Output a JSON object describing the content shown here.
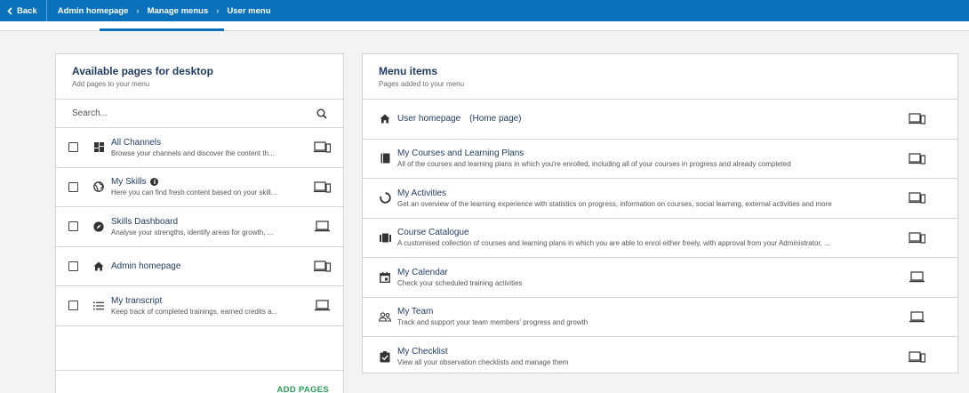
{
  "topbar": {
    "back_label": "Back",
    "breadcrumbs": [
      "Admin homepage",
      "Manage menus",
      "User menu"
    ],
    "accent": "#0a72bd"
  },
  "available": {
    "title": "Available pages for desktop",
    "subtitle": "Add pages to your menu",
    "search_placeholder": "Search...",
    "items": [
      {
        "title": "All Channels",
        "desc": "Browse your channels and discover the content th...",
        "icon": "grid-icon",
        "device": "desktop-mobile-icon"
      },
      {
        "title": "My Skills",
        "desc": "Here you can find fresh content based on your skill...",
        "icon": "globe-icon",
        "device": "desktop-mobile-icon",
        "info": "i"
      },
      {
        "title": "Skills Dashboard",
        "desc": "Analyse your strengths, identify areas for growth, ...",
        "icon": "compass-icon",
        "device": "laptop-icon"
      },
      {
        "title": "Admin homepage",
        "desc": "",
        "icon": "home-icon",
        "device": "desktop-mobile-icon"
      },
      {
        "title": "My transcript",
        "desc": "Keep track of completed trainings, earned credits a...",
        "icon": "list-icon",
        "device": "laptop-icon"
      }
    ],
    "add_label": "ADD PAGES",
    "add_color": "#2a9d57"
  },
  "menu": {
    "title": "Menu items",
    "subtitle": "Pages added to your menu",
    "items": [
      {
        "title": "User homepage",
        "suffix": "(Home page)",
        "desc": "",
        "icon": "home-icon",
        "device": "desktop-mobile-icon"
      },
      {
        "title": "My Courses and Learning Plans",
        "desc": "All of the courses and learning plans in which you're enrolled, including all of your courses in progress and already completed",
        "icon": "book-icon",
        "device": "desktop-mobile-icon"
      },
      {
        "title": "My Activities",
        "desc": "Get an overview of the learning experience with statistics on progress, information on courses, social learning, external activities and more",
        "icon": "progress-ring-icon",
        "device": "desktop-mobile-icon"
      },
      {
        "title": "Course Catalogue",
        "desc": "A customised collection of courses and learning plans in which you are able to enrol either freely, with approval from your Administrator, ...",
        "icon": "catalogue-icon",
        "device": "desktop-mobile-icon"
      },
      {
        "title": "My Calendar",
        "desc": "Check your scheduled training activities",
        "icon": "calendar-icon",
        "device": "laptop-icon"
      },
      {
        "title": "My Team",
        "desc": "Track and support your team members' progress and growth",
        "icon": "team-icon",
        "device": "laptop-icon"
      },
      {
        "title": "My Checklist",
        "desc": "View all your observation checklists and manage them",
        "icon": "checklist-icon",
        "device": "desktop-mobile-icon"
      }
    ]
  }
}
